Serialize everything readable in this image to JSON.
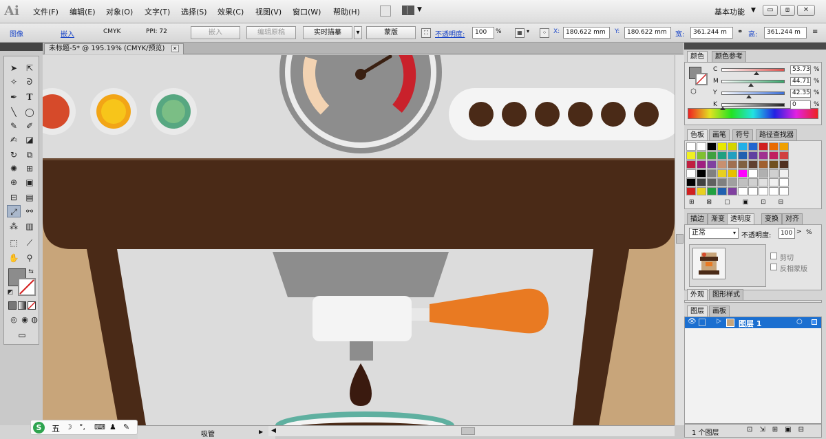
{
  "app": {
    "logo": "Ai"
  },
  "menu": [
    "文件(F)",
    "编辑(E)",
    "对象(O)",
    "文字(T)",
    "选择(S)",
    "效果(C)",
    "视图(V)",
    "窗口(W)",
    "帮助(H)"
  ],
  "workspace": {
    "label": "基本功能",
    "arrow": "▼"
  },
  "window_buttons": [
    "▭",
    "⧈",
    "✕"
  ],
  "control_bar": {
    "image_label": "图像",
    "embed_link": "嵌入",
    "cmyk": "CMYK",
    "ppi": "PPI: 72",
    "embed_btn": "嵌入",
    "edit_original_btn": "编辑原稿",
    "live_trace_btn": "实时描摹",
    "mask_btn": "蒙版",
    "opacity_label": "不透明度:",
    "opacity_value": "100",
    "opacity_unit": "%",
    "x_label": "X:",
    "x_value": "180.622 mm",
    "y_label": "Y:",
    "y_value": "180.622 mm",
    "w_label": "宽:",
    "w_value": "361.244 m",
    "h_label": "高:",
    "h_value": "361.244 m"
  },
  "doc_tab": {
    "title": "未标题-5* @ 195.19% (CMYK/预览)",
    "close": "✕"
  },
  "status": {
    "tool": "吸管",
    "arrow": "▶"
  },
  "ime": {
    "logo": "S",
    "mode": "五"
  },
  "color_panel": {
    "tabs": [
      "颜色",
      "颜色参考"
    ],
    "channels": [
      {
        "label": "C",
        "value": "53.73",
        "unit": "%",
        "pos": 0.54,
        "color": "#d9534f"
      },
      {
        "label": "M",
        "value": "44.71",
        "unit": "%",
        "pos": 0.45,
        "color": "#3aa76d"
      },
      {
        "label": "Y",
        "value": "42.35",
        "unit": "%",
        "pos": 0.42,
        "color": "#3b6fd8"
      },
      {
        "label": "K",
        "value": "0",
        "unit": "%",
        "pos": 0.0,
        "color": "#222222"
      }
    ]
  },
  "swatches_panel": {
    "tabs": [
      "色板",
      "画笔",
      "符号",
      "路径查找器"
    ]
  },
  "transparency_panel": {
    "tabs": [
      "描边",
      "渐变",
      "透明度",
      "变换",
      "对齐"
    ],
    "blend_mode": "正常",
    "opacity_label": "不透明度:",
    "opacity_value": "100",
    "opacity_unit": "%",
    "clip_label": "剪切",
    "invert_label": "反相蒙版"
  },
  "appearance_panel": {
    "tabs": [
      "外观",
      "图形样式"
    ]
  },
  "layers_panel": {
    "tabs": [
      "图层",
      "画板"
    ],
    "layer_name": "图层 1",
    "footer": "1 个图层"
  },
  "colors": {
    "brown": "#4a2a17",
    "orange": "#e97a22",
    "tan": "#c8a57a",
    "gauge_red": "#c9212b",
    "gauge_peach": "#f3d3b2",
    "accent_blue": "#1b6fd0"
  }
}
